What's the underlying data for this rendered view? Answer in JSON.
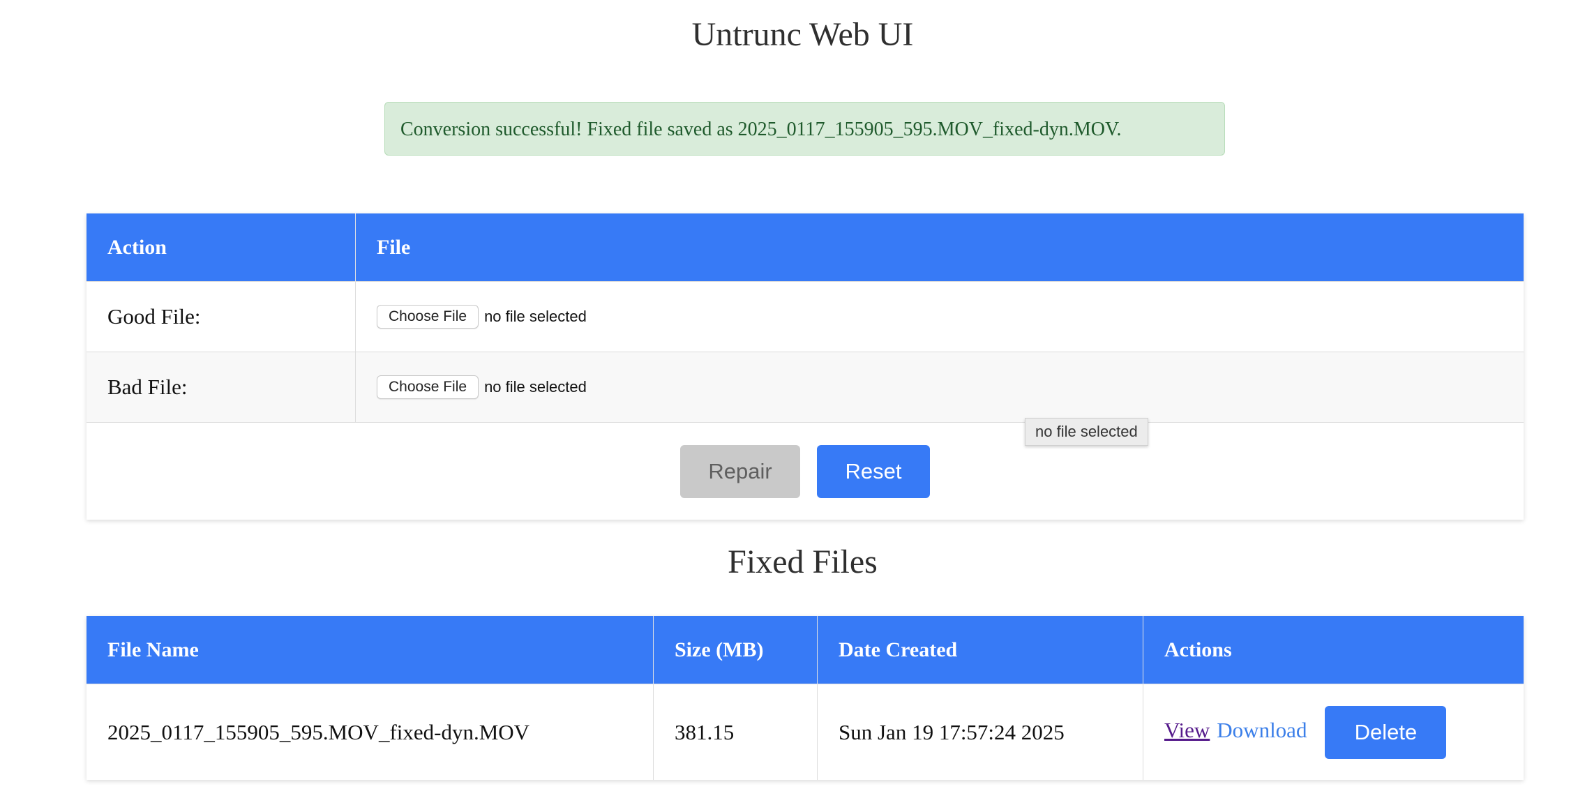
{
  "page": {
    "title": "Untrunc Web UI"
  },
  "alert": {
    "message": "Conversion successful! Fixed file saved as 2025_0117_155905_595.MOV_fixed-dyn.MOV."
  },
  "upload_table": {
    "headers": [
      "Action",
      "File"
    ],
    "rows": [
      {
        "label": "Good File:",
        "choose_label": "Choose File",
        "status": "no file selected"
      },
      {
        "label": "Bad File:",
        "choose_label": "Choose File",
        "status": "no file selected"
      }
    ],
    "repair_label": "Repair",
    "reset_label": "Reset"
  },
  "tooltip": {
    "text": "no file selected"
  },
  "fixed_files": {
    "title": "Fixed Files",
    "headers": [
      "File Name",
      "Size (MB)",
      "Date Created",
      "Actions"
    ],
    "rows": [
      {
        "file_name": "2025_0117_155905_595.MOV_fixed-dyn.MOV",
        "size": "381.15",
        "date": "Sun Jan 19 17:57:24 2025",
        "view_label": "View",
        "download_label": "Download",
        "delete_label": "Delete"
      }
    ]
  },
  "colors": {
    "header_blue": "#377af6",
    "alert_bg": "#d9ecda",
    "alert_text": "#1f5a2c",
    "disabled_gray": "#c9c9c9",
    "visited_link": "#551a8b",
    "link_blue": "#3a7ee9"
  }
}
